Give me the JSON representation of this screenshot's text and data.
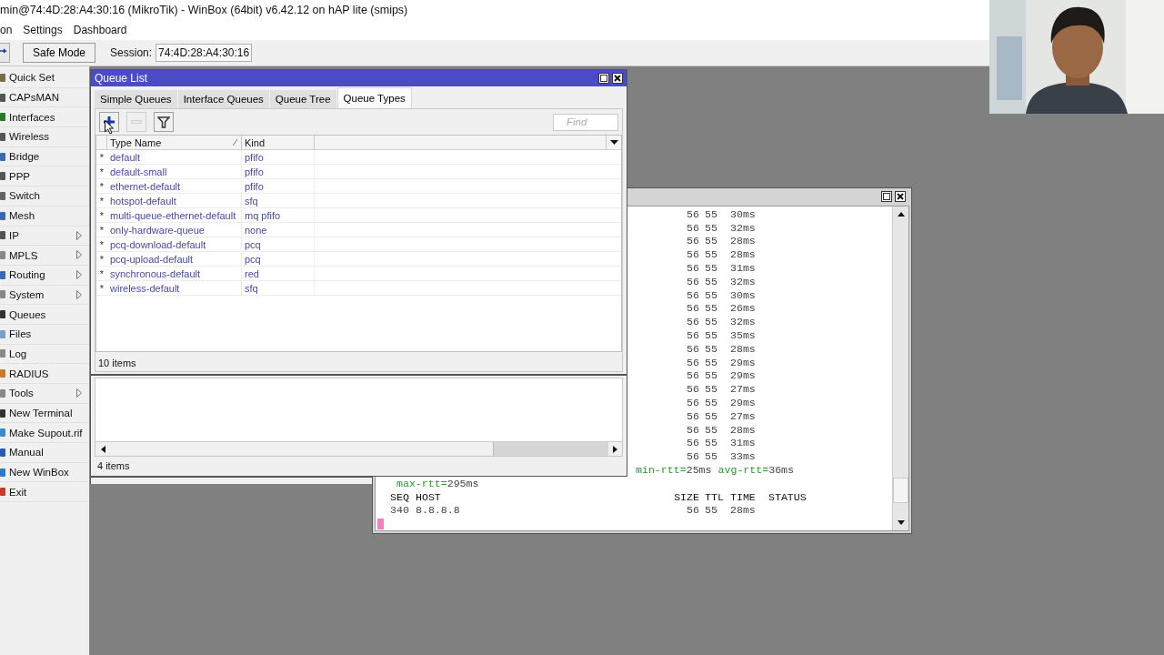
{
  "title_bar": {
    "title": "min@74:4D:28:A4:30:16 (MikroTik) - WinBox (64bit) v6.42.12 on hAP lite (smips)"
  },
  "menu": [
    "on",
    "Settings",
    "Dashboard"
  ],
  "toolbar": {
    "safe_mode": "Safe Mode",
    "session_label": "Session:",
    "session_value": "74:4D:28:A4:30:16"
  },
  "webcam": {
    "kind": "picture"
  },
  "sidebar": {
    "items": [
      {
        "label": "Quick Set",
        "submenu": false
      },
      {
        "label": "CAPsMAN",
        "submenu": false
      },
      {
        "label": "Interfaces",
        "submenu": false
      },
      {
        "label": "Wireless",
        "submenu": false
      },
      {
        "label": "Bridge",
        "submenu": false
      },
      {
        "label": "PPP",
        "submenu": false
      },
      {
        "label": "Switch",
        "submenu": false
      },
      {
        "label": "Mesh",
        "submenu": false
      },
      {
        "label": "IP",
        "submenu": true
      },
      {
        "label": "MPLS",
        "submenu": true
      },
      {
        "label": "Routing",
        "submenu": true
      },
      {
        "label": "System",
        "submenu": true
      },
      {
        "label": "Queues",
        "submenu": false
      },
      {
        "label": "Files",
        "submenu": false
      },
      {
        "label": "Log",
        "submenu": false
      },
      {
        "label": "RADIUS",
        "submenu": false
      },
      {
        "label": "Tools",
        "submenu": true
      },
      {
        "label": "New Terminal",
        "submenu": false
      },
      {
        "label": "Make Supout.rif",
        "submenu": false
      },
      {
        "label": "Manual",
        "submenu": false
      },
      {
        "label": "New WinBox",
        "submenu": false
      },
      {
        "label": "Exit",
        "submenu": false
      }
    ]
  },
  "queue_list": {
    "title": "Queue List",
    "tabs": [
      {
        "label": "Simple Queues",
        "selected": false
      },
      {
        "label": "Interface Queues",
        "selected": false
      },
      {
        "label": "Queue Tree",
        "selected": false
      },
      {
        "label": "Queue Types",
        "selected": true
      }
    ],
    "tools": [
      {
        "kind": "add",
        "disabled": false
      },
      {
        "kind": "remove",
        "disabled": true
      },
      {
        "kind": "filter",
        "disabled": false
      }
    ],
    "find": {
      "placeholder": "Find"
    },
    "columns": [
      "Type Name",
      "Kind"
    ],
    "rows": [
      {
        "flag": "*",
        "name": "default",
        "kind": "pfifo"
      },
      {
        "flag": "*",
        "name": "default-small",
        "kind": "pfifo"
      },
      {
        "flag": "*",
        "name": "ethernet-default",
        "kind": "pfifo"
      },
      {
        "flag": "*",
        "name": "hotspot-default",
        "kind": "sfq"
      },
      {
        "flag": "*",
        "name": "multi-queue-ethernet-default",
        "kind": "mq pfifo"
      },
      {
        "flag": "*",
        "name": "only-hardware-queue",
        "kind": "none"
      },
      {
        "flag": "*",
        "name": "pcq-download-default",
        "kind": "pcq"
      },
      {
        "flag": "*",
        "name": "pcq-upload-default",
        "kind": "pcq"
      },
      {
        "flag": "*",
        "name": "synchronous-default",
        "kind": "red"
      },
      {
        "flag": "*",
        "name": "wireless-default",
        "kind": "sfq"
      }
    ],
    "status": "10 items"
  },
  "lower_window": {
    "status": "4 items"
  },
  "terminal": {
    "rows": [
      {
        "size": "56",
        "ttl": "55",
        "time": "30ms"
      },
      {
        "size": "56",
        "ttl": "55",
        "time": "32ms"
      },
      {
        "size": "56",
        "ttl": "55",
        "time": "28ms"
      },
      {
        "size": "56",
        "ttl": "55",
        "time": "28ms"
      },
      {
        "size": "56",
        "ttl": "55",
        "time": "31ms"
      },
      {
        "size": "56",
        "ttl": "55",
        "time": "32ms"
      },
      {
        "size": "56",
        "ttl": "55",
        "time": "30ms"
      },
      {
        "size": "56",
        "ttl": "55",
        "time": "26ms"
      },
      {
        "size": "56",
        "ttl": "55",
        "time": "32ms"
      },
      {
        "size": "56",
        "ttl": "55",
        "time": "35ms"
      },
      {
        "size": "56",
        "ttl": "55",
        "time": "28ms"
      },
      {
        "size": "56",
        "ttl": "55",
        "time": "29ms"
      },
      {
        "size": "56",
        "ttl": "55",
        "time": "29ms"
      },
      {
        "size": "56",
        "ttl": "55",
        "time": "27ms"
      },
      {
        "size": "56",
        "ttl": "55",
        "time": "29ms"
      },
      {
        "size": "56",
        "ttl": "55",
        "time": "27ms"
      },
      {
        "size": "56",
        "ttl": "55",
        "time": "28ms"
      },
      {
        "size": "56",
        "ttl": "55",
        "time": "31ms"
      },
      {
        "size": "56",
        "ttl": "55",
        "time": "33ms"
      }
    ],
    "stats": [
      {
        "label": "min-rtt=",
        "value": "25ms"
      },
      {
        "label": "avg-rtt=",
        "value": "36ms"
      }
    ],
    "stats_2": [
      {
        "label": "max-rtt=",
        "value": "295ms"
      }
    ],
    "header": {
      "seq": "SEQ",
      "host": "HOST",
      "size": "SIZE",
      "ttl": "TTL",
      "time": "TIME",
      "status": "STATUS"
    },
    "last_row": {
      "seq": "340",
      "host": "8.8.8.8",
      "size": "56",
      "ttl": "55",
      "time": "28ms"
    }
  }
}
